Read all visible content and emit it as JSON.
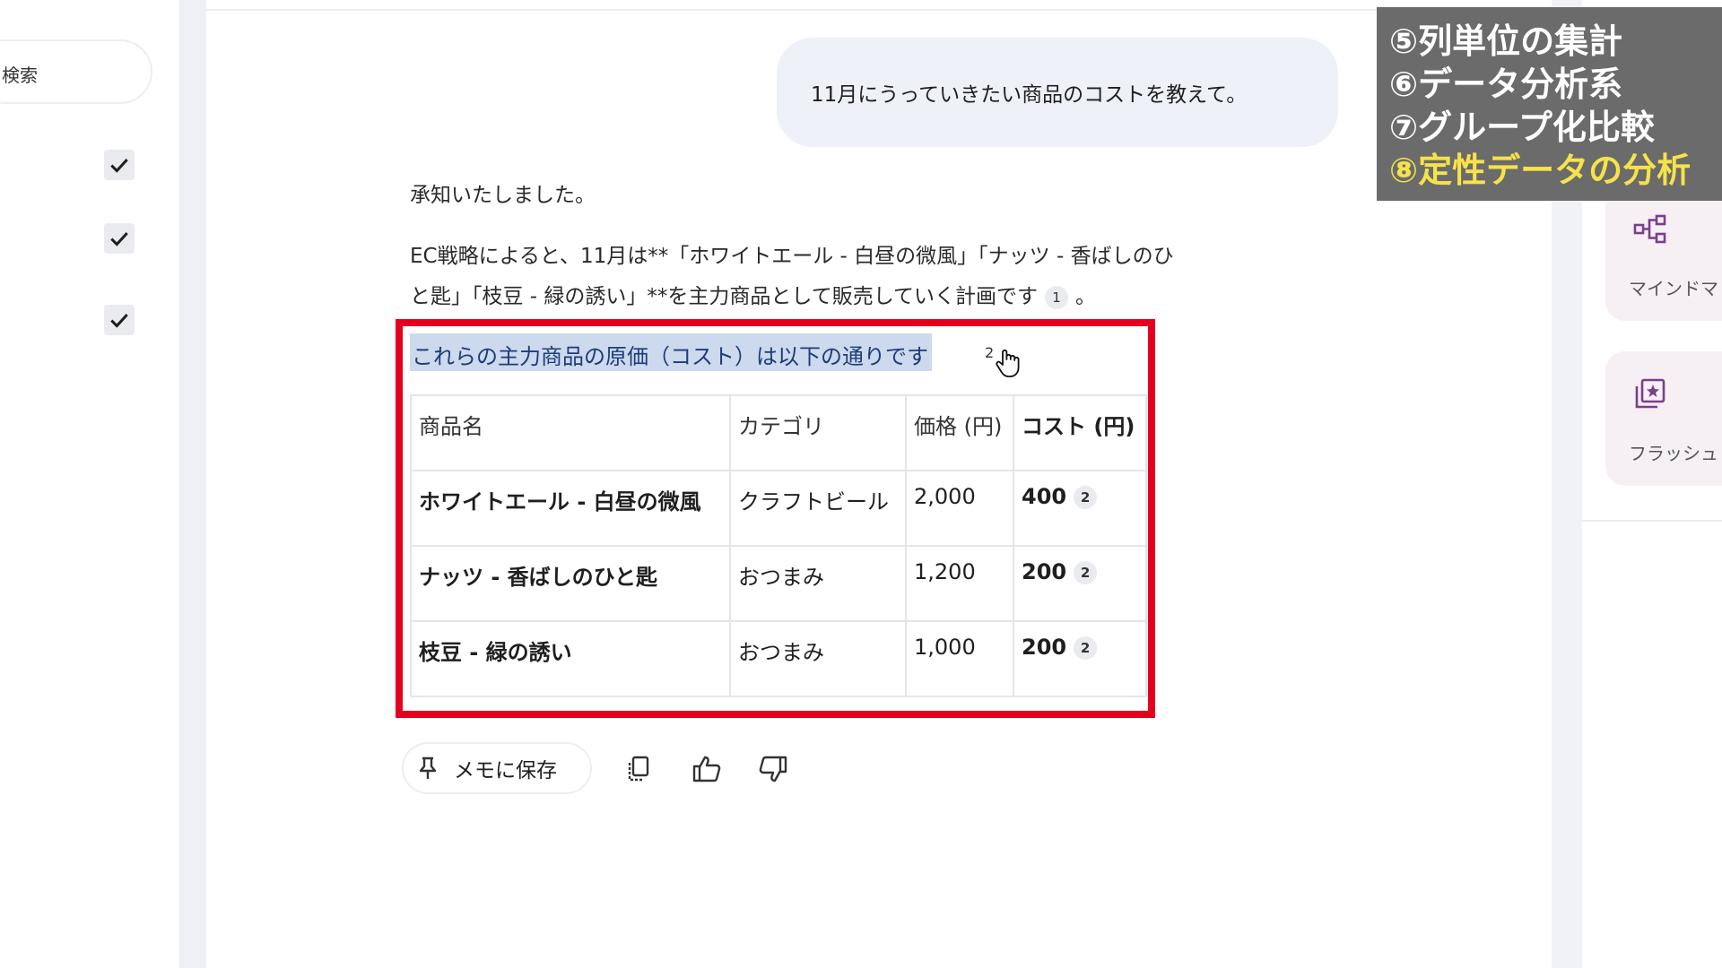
{
  "sidebar": {
    "search_label": "検索",
    "checkboxes": [
      "checked",
      "checked",
      "checked"
    ]
  },
  "chat": {
    "user_message": "11月にうっていきたい商品のコストを教えて。",
    "reply_ack": "承知いたしました。",
    "reply_line1": "EC戦略によると、11月は**「ホワイトエール - 白昼の微風」「ナッツ - 香ばしのひ",
    "reply_line2": "と匙」「枝豆 - 緑の誘い」**を主力商品として販売していく計画です",
    "reply_line2_cite": "1",
    "reply_line2_end": "。",
    "selected_sentence": "これらの主力商品の原価（コスト）は以下の通りです",
    "selected_cite": "2"
  },
  "table": {
    "headers": [
      "商品名",
      "カテゴリ",
      "価格 (円)",
      "コスト (円)"
    ],
    "rows": [
      {
        "name": "ホワイトエール - 白昼の微風",
        "category": "クラフトビール",
        "price": "2,000",
        "cost": "400",
        "cite": "2"
      },
      {
        "name": "ナッツ - 香ばしのひと匙",
        "category": "おつまみ",
        "price": "1,200",
        "cost": "200",
        "cite": "2"
      },
      {
        "name": "枝豆 - 緑の誘い",
        "category": "おつまみ",
        "price": "1,000",
        "cost": "200",
        "cite": "2"
      }
    ]
  },
  "actions": {
    "save_memo_label": "メモに保存"
  },
  "right_panel": {
    "cards": [
      {
        "label": "マインドマ",
        "icon": "mindmap-icon"
      },
      {
        "label": "フラッシュ",
        "icon": "flashcard-icon"
      }
    ]
  },
  "overlay": {
    "items": [
      "⑤列単位の集計",
      "⑥データ分析系",
      "⑦グループ化比較",
      "⑧定性データの分析"
    ],
    "active_index": 3,
    "active_color": "#f6e24a"
  },
  "colors": {
    "highlight_border": "#e60020",
    "selection": "#cdd9ec"
  }
}
